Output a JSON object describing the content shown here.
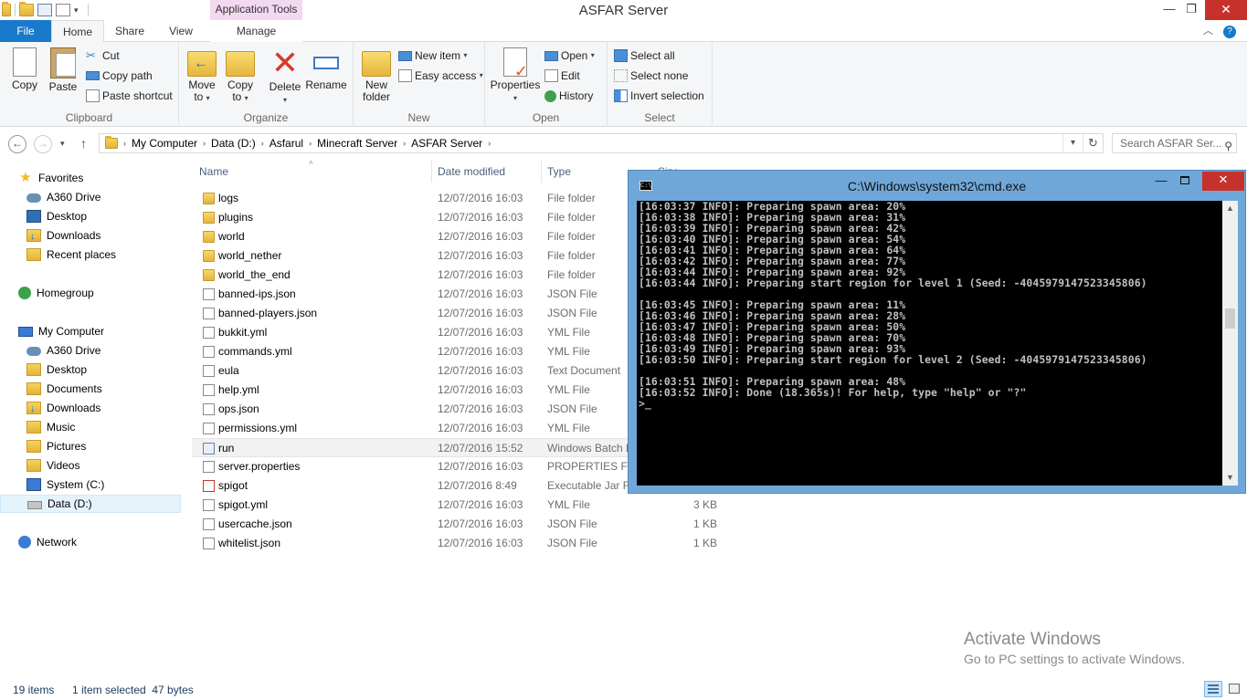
{
  "window": {
    "title": "ASFAR Server",
    "contextual_tab_title": "Application Tools",
    "controls": {
      "minimize": "—",
      "maximize": "❐",
      "close": "✕"
    }
  },
  "ribbon_tabs": [
    "File",
    "Home",
    "Share",
    "View",
    "Manage"
  ],
  "ribbon": {
    "clipboard": {
      "label": "Clipboard",
      "copy": "Copy",
      "paste": "Paste",
      "cut": "Cut",
      "copy_path": "Copy path",
      "paste_shortcut": "Paste shortcut"
    },
    "organize": {
      "label": "Organize",
      "move_to": "Move",
      "move_to_2": "to",
      "copy_to": "Copy",
      "copy_to_2": "to",
      "delete": "Delete",
      "rename": "Rename"
    },
    "new": {
      "label": "New",
      "new_folder": "New",
      "new_folder_2": "folder",
      "new_item": "New item",
      "easy_access": "Easy access"
    },
    "open": {
      "label": "Open",
      "properties": "Properties",
      "open": "Open",
      "edit": "Edit",
      "history": "History"
    },
    "select": {
      "label": "Select",
      "select_all": "Select all",
      "select_none": "Select none",
      "invert_selection": "Invert selection"
    }
  },
  "address": {
    "crumbs": [
      "My Computer",
      "Data (D:)",
      "Asfarul",
      "Minecraft Server",
      "ASFAR Server"
    ],
    "search_placeholder": "Search ASFAR Ser..."
  },
  "nav_pane": {
    "favorites": "Favorites",
    "fav_items": [
      "A360 Drive",
      "Desktop",
      "Downloads",
      "Recent places"
    ],
    "homegroup": "Homegroup",
    "my_computer": "My Computer",
    "pc_items": [
      "A360 Drive",
      "Desktop",
      "Documents",
      "Downloads",
      "Music",
      "Pictures",
      "Videos",
      "System (C:)",
      "Data (D:)"
    ],
    "network": "Network"
  },
  "columns": {
    "name": "Name",
    "date": "Date modified",
    "type": "Type",
    "size": "Size"
  },
  "files": [
    {
      "name": "logs",
      "date": "12/07/2016 16:03",
      "type": "File folder",
      "size": "",
      "kind": "folder"
    },
    {
      "name": "plugins",
      "date": "12/07/2016 16:03",
      "type": "File folder",
      "size": "",
      "kind": "folder"
    },
    {
      "name": "world",
      "date": "12/07/2016 16:03",
      "type": "File folder",
      "size": "",
      "kind": "folder"
    },
    {
      "name": "world_nether",
      "date": "12/07/2016 16:03",
      "type": "File folder",
      "size": "",
      "kind": "folder"
    },
    {
      "name": "world_the_end",
      "date": "12/07/2016 16:03",
      "type": "File folder",
      "size": "",
      "kind": "folder"
    },
    {
      "name": "banned-ips.json",
      "date": "12/07/2016 16:03",
      "type": "JSON File",
      "size": "",
      "kind": "file"
    },
    {
      "name": "banned-players.json",
      "date": "12/07/2016 16:03",
      "type": "JSON File",
      "size": "",
      "kind": "file"
    },
    {
      "name": "bukkit.yml",
      "date": "12/07/2016 16:03",
      "type": "YML File",
      "size": "",
      "kind": "file"
    },
    {
      "name": "commands.yml",
      "date": "12/07/2016 16:03",
      "type": "YML File",
      "size": "",
      "kind": "file"
    },
    {
      "name": "eula",
      "date": "12/07/2016 16:03",
      "type": "Text Document",
      "size": "",
      "kind": "file"
    },
    {
      "name": "help.yml",
      "date": "12/07/2016 16:03",
      "type": "YML File",
      "size": "",
      "kind": "file"
    },
    {
      "name": "ops.json",
      "date": "12/07/2016 16:03",
      "type": "JSON File",
      "size": "",
      "kind": "file"
    },
    {
      "name": "permissions.yml",
      "date": "12/07/2016 16:03",
      "type": "YML File",
      "size": "",
      "kind": "file"
    },
    {
      "name": "run",
      "date": "12/07/2016 15:52",
      "type": "Windows Batch File",
      "size": "",
      "kind": "bat",
      "selected": true
    },
    {
      "name": "server.properties",
      "date": "12/07/2016 16:03",
      "type": "PROPERTIES File",
      "size": "",
      "kind": "file"
    },
    {
      "name": "spigot",
      "date": "12/07/2016 8:49",
      "type": "Executable Jar File",
      "size": "",
      "kind": "jar"
    },
    {
      "name": "spigot.yml",
      "date": "12/07/2016 16:03",
      "type": "YML File",
      "size": "3 KB",
      "kind": "file"
    },
    {
      "name": "usercache.json",
      "date": "12/07/2016 16:03",
      "type": "JSON File",
      "size": "1 KB",
      "kind": "file"
    },
    {
      "name": "whitelist.json",
      "date": "12/07/2016 16:03",
      "type": "JSON File",
      "size": "1 KB",
      "kind": "file"
    }
  ],
  "cmd": {
    "title": "C:\\Windows\\system32\\cmd.exe",
    "icon_label": "C:\\",
    "lines": [
      "[16:03:37 INFO]: Preparing spawn area: 20%",
      "[16:03:38 INFO]: Preparing spawn area: 31%",
      "[16:03:39 INFO]: Preparing spawn area: 42%",
      "[16:03:40 INFO]: Preparing spawn area: 54%",
      "[16:03:41 INFO]: Preparing spawn area: 64%",
      "[16:03:42 INFO]: Preparing spawn area: 77%",
      "[16:03:44 INFO]: Preparing spawn area: 92%",
      "[16:03:44 INFO]: Preparing start region for level 1 (Seed: -4045979147523345806)",
      "",
      "[16:03:45 INFO]: Preparing spawn area: 11%",
      "[16:03:46 INFO]: Preparing spawn area: 28%",
      "[16:03:47 INFO]: Preparing spawn area: 50%",
      "[16:03:48 INFO]: Preparing spawn area: 70%",
      "[16:03:49 INFO]: Preparing spawn area: 93%",
      "[16:03:50 INFO]: Preparing start region for level 2 (Seed: -4045979147523345806)",
      "",
      "[16:03:51 INFO]: Preparing spawn area: 48%",
      "[16:03:52 INFO]: Done (18.365s)! For help, type \"help\" or \"?\"",
      ">_"
    ]
  },
  "watermark": {
    "line1": "Activate Windows",
    "line2": "Go to PC settings to activate Windows."
  },
  "status": {
    "count": "19 items",
    "selection": "1 item selected  47 bytes"
  }
}
